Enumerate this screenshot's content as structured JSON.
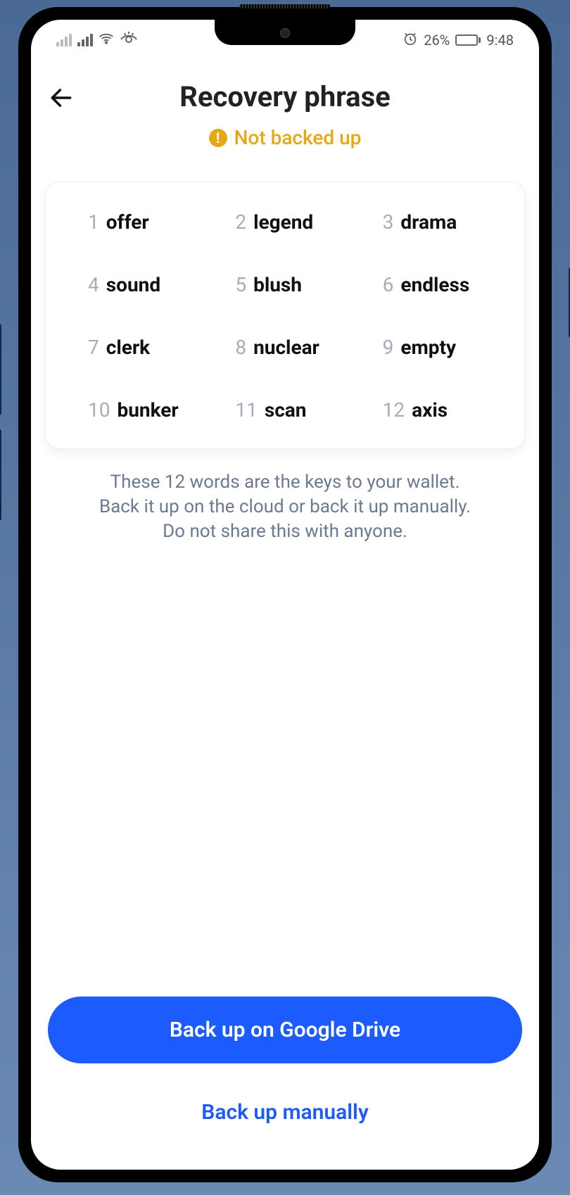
{
  "status_bar": {
    "battery_percent": "26%",
    "time": "9:48",
    "battery_fill_width": "26%"
  },
  "header": {
    "title": "Recovery phrase",
    "status_label": "Not backed up"
  },
  "phrase": {
    "words": [
      {
        "n": "1",
        "w": "offer"
      },
      {
        "n": "2",
        "w": "legend"
      },
      {
        "n": "3",
        "w": "drama"
      },
      {
        "n": "4",
        "w": "sound"
      },
      {
        "n": "5",
        "w": "blush"
      },
      {
        "n": "6",
        "w": "endless"
      },
      {
        "n": "7",
        "w": "clerk"
      },
      {
        "n": "8",
        "w": "nuclear"
      },
      {
        "n": "9",
        "w": "empty"
      },
      {
        "n": "10",
        "w": "bunker"
      },
      {
        "n": "11",
        "w": "scan"
      },
      {
        "n": "12",
        "w": "axis"
      }
    ]
  },
  "info": {
    "line1": "These 12 words are the keys to your wallet.",
    "line2": "Back it up on the cloud or back it up manually.",
    "line3": "Do not share this with anyone."
  },
  "buttons": {
    "primary": "Back up on Google Drive",
    "secondary": "Back up manually"
  }
}
